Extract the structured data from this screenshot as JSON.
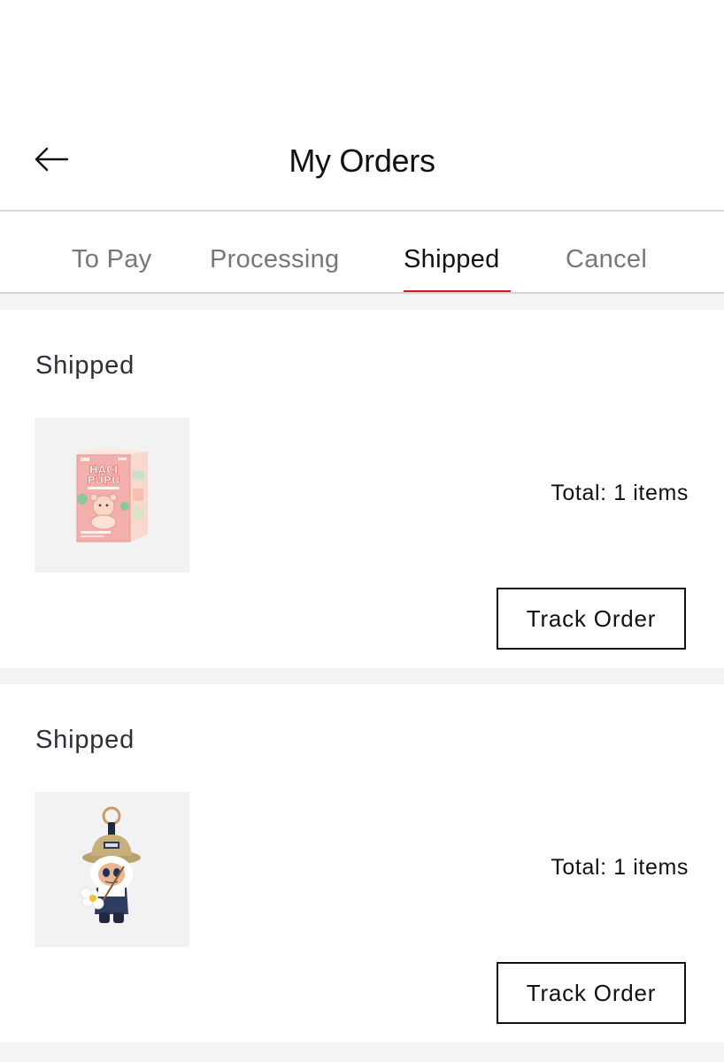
{
  "header": {
    "title": "My Orders",
    "back_icon": "arrow-left-icon"
  },
  "tabs": [
    {
      "label": "To Pay",
      "active": false
    },
    {
      "label": "Processing",
      "active": false
    },
    {
      "label": "Shipped",
      "active": true
    },
    {
      "label": "Cancel",
      "active": false
    }
  ],
  "colors": {
    "accent": "#d8122a",
    "divider": "#d6d6d6",
    "section_background": "#f4f4f4",
    "thumbnail_background": "#f2f2f2"
  },
  "orders": [
    {
      "status": "Shipped",
      "product_image": "pink-blind-box-figure-image",
      "box_lettering": [
        "HACI",
        "PUPU"
      ],
      "total": "Total: 1 items",
      "action_label": "Track Order"
    },
    {
      "status": "Shipped",
      "product_image": "plush-keychain-figure-image",
      "total": "Total: 1 items",
      "action_label": "Track Order"
    }
  ]
}
